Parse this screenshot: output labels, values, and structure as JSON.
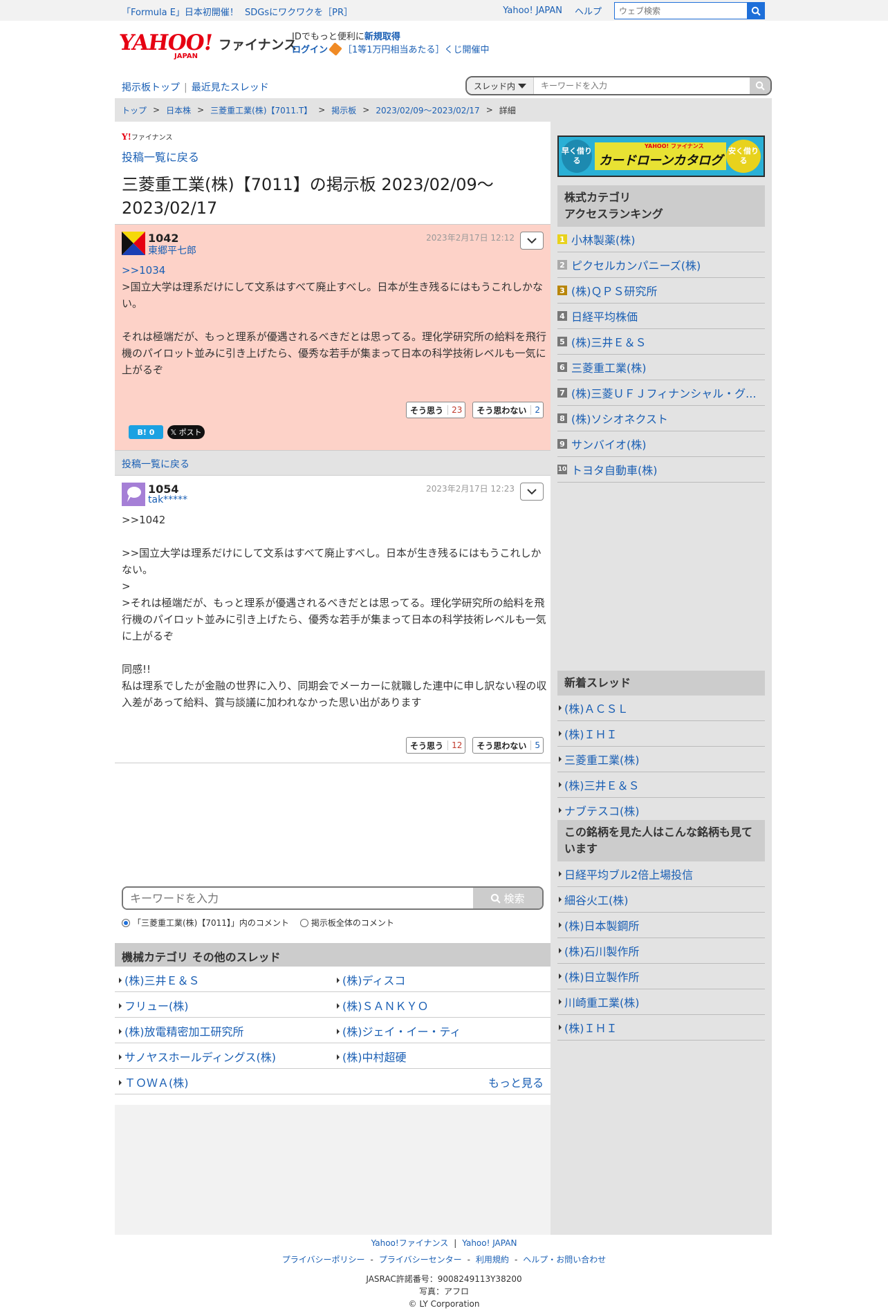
{
  "topbar": {
    "promo1": "「Formula E」日本初開催！",
    "promo2": "SDGsにワクワクを［PR］",
    "yahoo_japan": "Yahoo! JAPAN",
    "help": "ヘルプ",
    "web_search_placeholder": "ウェブ検索"
  },
  "header": {
    "logo_yahoo": "YAHOO!",
    "logo_japan": "JAPAN",
    "logo_finance": "ファイナンス",
    "id_text": "IDでもっと便利に",
    "register": "新規取得",
    "login": "ログイン",
    "lottery": "［1等1万円相当あたる］くじ開催中"
  },
  "nav": {
    "board_top": "掲示板トップ",
    "recent": "最近見たスレッド",
    "scope": "スレッド内",
    "keyword_placeholder": "キーワードを入力"
  },
  "breadcrumb": [
    "トップ",
    "日本株",
    "三菱重工業(株)【7011.T】",
    "掲示板",
    "2023/02/09〜2023/02/17",
    "詳細"
  ],
  "main": {
    "small_logo": "ファイナンス",
    "back_link": "投稿一覧に戻る",
    "title": "三菱重工業(株)【7011】の掲示板 2023/02/09〜2023/02/17"
  },
  "posts": [
    {
      "number": "1042",
      "user": "東郷平七郎",
      "date": "2023年2月17日 12:12",
      "reply_link": ">>1034",
      "body": ">国立大学は理系だけにして文系はすべて廃止すべし。日本が生き残るにはもうこれしかない。\n\nそれは極端だが、もっと理系が優遇されるべきだとは思ってる。理化学研究所の給料を飛行機のパイロット並みに引き上げたら、優秀な若手が集まって日本の科学技術レベルも一気に上がるぞ",
      "agree_label": "そう思う",
      "agree_count": "23",
      "disagree_label": "そう思わない",
      "disagree_count": "2",
      "hatena_label": "B! 0",
      "x_label": "𝕏 ポスト"
    },
    {
      "number": "1054",
      "user": "tak*****",
      "date": "2023年2月17日 12:23",
      "body": ">>1042\n\n>>国立大学は理系だけにして文系はすべて廃止すべし。日本が生き残るにはもうこれしかない。\n>\n>それは極端だが、もっと理系が優遇されるべきだとは思ってる。理化学研究所の給料を飛行機のパイロット並みに引き上げたら、優秀な若手が集まって日本の科学技術レベルも一気に上がるぞ\n\n同感!!\n私は理系でしたが金融の世界に入り、同期会でメーカーに就職した連中に申し訳ない程の収入差があって給料、賞与談議に加われなかった思い出があります",
      "agree_label": "そう思う",
      "agree_count": "12",
      "disagree_label": "そう思わない",
      "disagree_count": "5"
    }
  ],
  "back_bar": "投稿一覧に戻る",
  "bottom_search": {
    "placeholder": "キーワードを入力",
    "button": "検索",
    "radio1": "「三菱重工業(株)【7011】」内のコメント",
    "radio2": "掲示板全体のコメント"
  },
  "other_threads": {
    "heading": "機械カテゴリ その他のスレッド",
    "items": [
      "(株)三井Ｅ＆Ｓ",
      "(株)ディスコ",
      "フリュー(株)",
      "(株)ＳＡＮＫＹＯ",
      "(株)放電精密加工研究所",
      "(株)ジェイ・イー・ティ",
      "サノヤスホールディングス(株)",
      "(株)中村超硬",
      "ＴＯＷＡ(株)"
    ],
    "more": "もっと見る"
  },
  "ad": {
    "left": "早く借りる",
    "brand": "YAHOO! ファイナンス",
    "title": "カードローンカタログ",
    "right": "安く借りる"
  },
  "ranking": {
    "heading1": "株式カテゴリ",
    "heading2": "アクセスランキング",
    "items": [
      "小林製薬(株)",
      "ピクセルカンパニーズ(株)",
      "(株)ＱＰＳ研究所",
      "日経平均株価",
      "(株)三井Ｅ＆Ｓ",
      "三菱重工業(株)",
      "(株)三菱ＵＦＪフィナンシャル・グ...",
      "(株)ソシオネクスト",
      "サンバイオ(株)",
      "トヨタ自動車(株)"
    ],
    "nums": [
      "1",
      "2",
      "3",
      "4",
      "5",
      "6",
      "7",
      "8",
      "9",
      "10"
    ]
  },
  "new_threads": {
    "heading": "新着スレッド",
    "items": [
      "(株)ＡＣＳＬ",
      "(株)ＩＨＩ",
      "三菱重工業(株)",
      "(株)三井Ｅ＆Ｓ",
      "ナブテスコ(株)"
    ]
  },
  "also_viewed": {
    "heading": "この銘柄を見た人はこんな銘柄も見ています",
    "items": [
      "日経平均ブル2倍上場投信",
      "細谷火工(株)",
      "(株)日本製鋼所",
      "(株)石川製作所",
      "(株)日立製作所",
      "川崎重工業(株)",
      "(株)ＩＨＩ"
    ]
  },
  "footer": {
    "finance": "Yahoo!ファイナンス",
    "japan": "Yahoo! JAPAN",
    "privacy": "プライバシーポリシー",
    "privacy_center": "プライバシーセンター",
    "terms": "利用規約",
    "help": "ヘルプ・お問い合わせ",
    "jasrac": "JASRAC許諾番号：9008249113Y38200",
    "photo": "写真：アフロ",
    "copyright": "© LY Corporation"
  },
  "colors": {
    "link": "#1a5fb4",
    "post_bg": "#fdd2c8",
    "accent_red": "#e60012",
    "search_blue": "#1e6fd9"
  }
}
